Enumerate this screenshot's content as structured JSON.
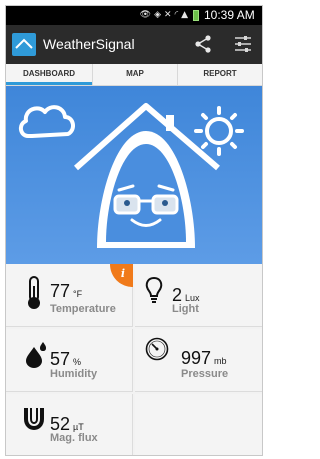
{
  "status_bar": {
    "time": "10:39 AM",
    "icons": [
      "eye-icon",
      "nfc-icon",
      "mute-icon",
      "wifi-icon",
      "signal-icon",
      "battery-icon"
    ]
  },
  "app_bar": {
    "title": "WeatherSignal",
    "actions": [
      "share-icon",
      "settings-sliders-icon"
    ],
    "colors": {
      "bar": "#2b2b2b",
      "logo": "#2f9ad8"
    }
  },
  "tabs": [
    {
      "label": "DASHBOARD",
      "selected": true
    },
    {
      "label": "MAP",
      "selected": false
    },
    {
      "label": "REPORT",
      "selected": false
    }
  ],
  "hero": {
    "background": "#4a8ede",
    "icons": [
      "cloud-icon",
      "house-mascot-icon",
      "sun-icon"
    ]
  },
  "info_badge": {
    "symbol": "i",
    "color": "#f07a1a"
  },
  "sensors": [
    {
      "id": "temperature",
      "value": "77",
      "unit": "°F",
      "label": "Temperature",
      "icon": "thermometer-icon"
    },
    {
      "id": "light",
      "value": "2",
      "unit": "Lux",
      "label": "Light",
      "icon": "light-bulb-icon"
    },
    {
      "id": "humidity",
      "value": "57",
      "unit": "%",
      "label": "Humidity",
      "icon": "water-drops-icon"
    },
    {
      "id": "pressure",
      "value": "997",
      "unit": "mb",
      "label": "Pressure",
      "icon": "pressure-gauge-icon"
    },
    {
      "id": "mag_flux",
      "value": "52",
      "unit": "µT",
      "label": "Mag. flux",
      "icon": "magnet-icon"
    }
  ]
}
